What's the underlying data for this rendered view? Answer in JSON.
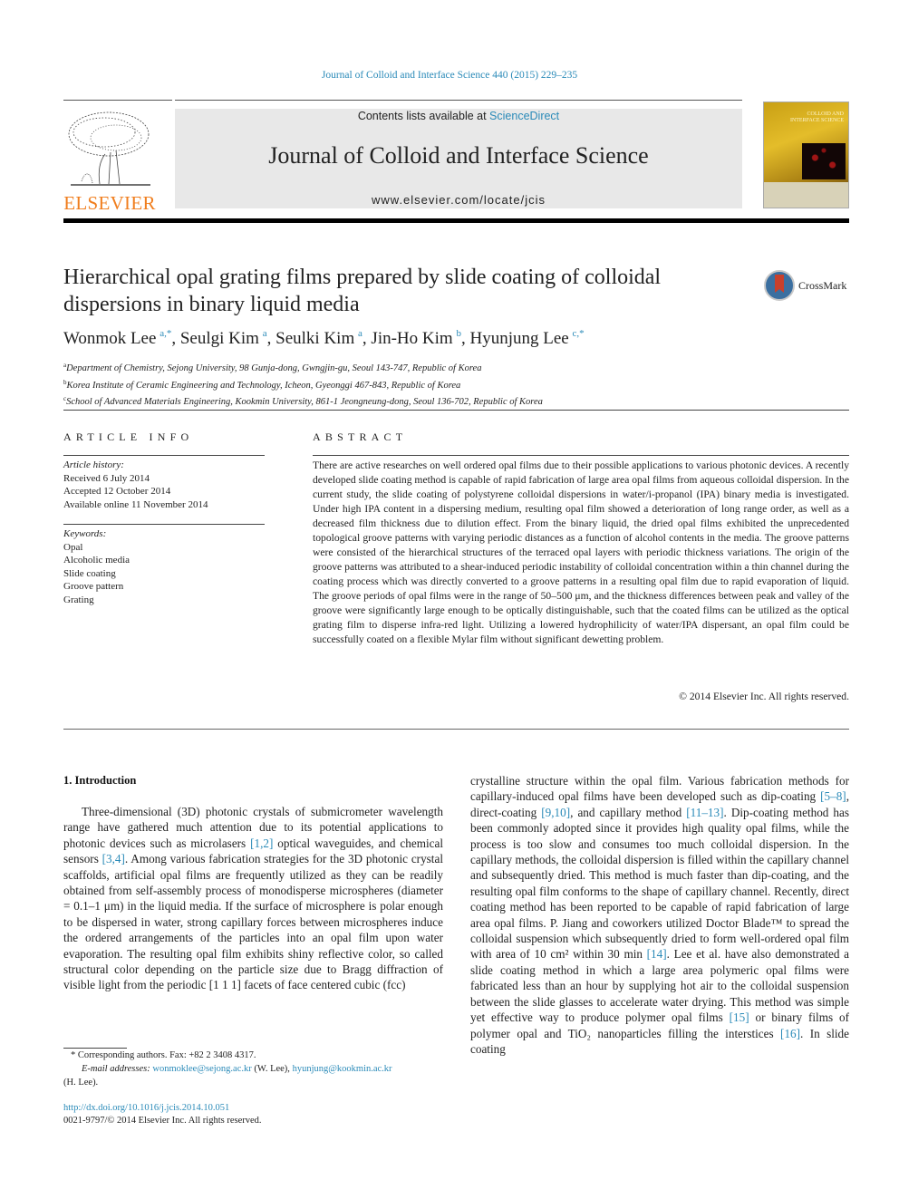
{
  "header": {
    "citation": "Journal of Colloid and Interface Science 440 (2015) 229–235",
    "contents_prefix": "Contents lists available at ",
    "contents_link": "ScienceDirect",
    "journal_name": "Journal of Colloid and Interface Science",
    "journal_url": "www.elsevier.com/locate/jcis",
    "publisher_logo_text": "ELSEVIER",
    "cover_title": "COLLOID AND INTERFACE SCIENCE",
    "crossmark_label": "CrossMark"
  },
  "article": {
    "title": "Hierarchical opal grating films prepared by slide coating of colloidal dispersions in binary liquid media",
    "authors": [
      {
        "name": "Wonmok Lee",
        "sup": "a,*",
        "sep": ", "
      },
      {
        "name": "Seulgi Kim",
        "sup": "a",
        "sep": ", "
      },
      {
        "name": "Seulki Kim",
        "sup": "a",
        "sep": ", "
      },
      {
        "name": "Jin-Ho Kim",
        "sup": "b",
        "sep": ", "
      },
      {
        "name": "Hyunjung Lee",
        "sup": "c,*",
        "sep": ""
      }
    ],
    "affiliations": [
      {
        "mark": "a",
        "text": "Department of Chemistry, Sejong University, 98 Gunja-dong, Gwngjin-gu, Seoul 143-747, Republic of Korea"
      },
      {
        "mark": "b",
        "text": "Korea Institute of Ceramic Engineering and Technology, Icheon, Gyeonggi 467-843, Republic of Korea"
      },
      {
        "mark": "c",
        "text": "School of Advanced Materials Engineering, Kookmin University, 861-1 Jeongneung-dong, Seoul 136-702, Republic of Korea"
      }
    ]
  },
  "article_info": {
    "label": "ARTICLE INFO",
    "history_label": "Article history:",
    "history": [
      "Received 6 July 2014",
      "Accepted 12 October 2014",
      "Available online 11 November 2014"
    ],
    "keywords_label": "Keywords:",
    "keywords": [
      "Opal",
      "Alcoholic media",
      "Slide coating",
      "Groove pattern",
      "Grating"
    ]
  },
  "abstract": {
    "label": "ABSTRACT",
    "text": "There are active researches on well ordered opal films due to their possible applications to various photonic devices. A recently developed slide coating method is capable of rapid fabrication of large area opal films from aqueous colloidal dispersion. In the current study, the slide coating of polystyrene colloidal dispersions in water/i-propanol (IPA) binary media is investigated. Under high IPA content in a dispersing medium, resulting opal film showed a deterioration of long range order, as well as a decreased film thickness due to dilution effect. From the binary liquid, the dried opal films exhibited the unprecedented topological groove patterns with varying periodic distances as a function of alcohol contents in the media. The groove patterns were consisted of the hierarchical structures of the terraced opal layers with periodic thickness variations. The origin of the groove patterns was attributed to a shear-induced periodic instability of colloidal concentration within a thin channel during the coating process which was directly converted to a groove patterns in a resulting opal film due to rapid evaporation of liquid. The groove periods of opal films were in the range of 50–500 μm, and the thickness differences between peak and valley of the groove were significantly large enough to be optically distinguishable, such that the coated films can be utilized as the optical grating film to disperse infra-red light. Utilizing a lowered hydrophilicity of water/IPA dispersant, an opal film could be successfully coated on a flexible Mylar film without significant dewetting problem.",
    "copyright": "© 2014 Elsevier Inc. All rights reserved."
  },
  "intro": {
    "heading": "1. Introduction",
    "left_parts": [
      {
        "t": "Three-dimensional (3D) photonic crystals of submicrometer wavelength range have gathered much attention due to its potential applications to photonic devices such as microlasers "
      },
      {
        "t": "[1,2]",
        "link": true
      },
      {
        "t": " optical waveguides, and chemical sensors "
      },
      {
        "t": "[3,4]",
        "link": true
      },
      {
        "t": ". Among various fabrication strategies for the 3D photonic crystal scaffolds, artificial opal films are frequently utilized as they can be readily obtained from self-assembly process of monodisperse microspheres (diameter = 0.1–1 μm) in the liquid media. If the surface of microsphere is polar enough to be dispersed in water, strong capillary forces between microspheres induce the ordered arrangements of the particles into an opal film upon water evaporation. The resulting opal film exhibits shiny reflective color, so called structural color depending on the particle size due to Bragg diffraction of visible light from the periodic [1 1 1] facets of face centered cubic (fcc)"
      }
    ],
    "right_parts": [
      {
        "t": "crystalline structure within the opal film. Various fabrication methods for capillary-induced opal films have been developed such as dip-coating "
      },
      {
        "t": "[5–8]",
        "link": true
      },
      {
        "t": ", direct-coating "
      },
      {
        "t": "[9,10]",
        "link": true
      },
      {
        "t": ", and capillary method "
      },
      {
        "t": "[11–13]",
        "link": true
      },
      {
        "t": ". Dip-coating method has been commonly adopted since it provides high quality opal films, while the process is too slow and consumes too much colloidal dispersion. In the capillary methods, the colloidal dispersion is filled within the capillary channel and subsequently dried. This method is much faster than dip-coating, and the resulting opal film conforms to the shape of capillary channel. Recently, direct coating method has been reported to be capable of rapid fabrication of large area opal films. P. Jiang and coworkers utilized Doctor Blade™ to spread the colloidal suspension which subsequently dried to form well-ordered opal film with area of 10 cm² within 30 min "
      },
      {
        "t": "[14]",
        "link": true
      },
      {
        "t": ". Lee et al. have also demonstrated a slide coating method in which a large area polymeric opal films were fabricated less than an hour by supplying hot air to the colloidal suspension between the slide glasses to accelerate water drying. This method was simple yet effective way to produce polymer opal films "
      },
      {
        "t": "[15]",
        "link": true
      },
      {
        "t": " or binary films of polymer opal and TiO₂ nanoparticles filling the interstices "
      },
      {
        "t": "[16]",
        "link": true
      },
      {
        "t": ". In slide coating"
      }
    ]
  },
  "footnotes": {
    "corresponding": "* Corresponding authors. Fax: +82 2 3408 4317.",
    "email_label": "E-mail addresses: ",
    "email1": "wonmoklee@sejong.ac.kr",
    "email1_who": " (W. Lee), ",
    "email2": "hyunjung@kookmin.ac.kr",
    "email2_who": " (H. Lee)."
  },
  "doi": "http://dx.doi.org/10.1016/j.jcis.2014.10.051",
  "issn_copyright": "0021-9797/© 2014 Elsevier Inc. All rights reserved."
}
